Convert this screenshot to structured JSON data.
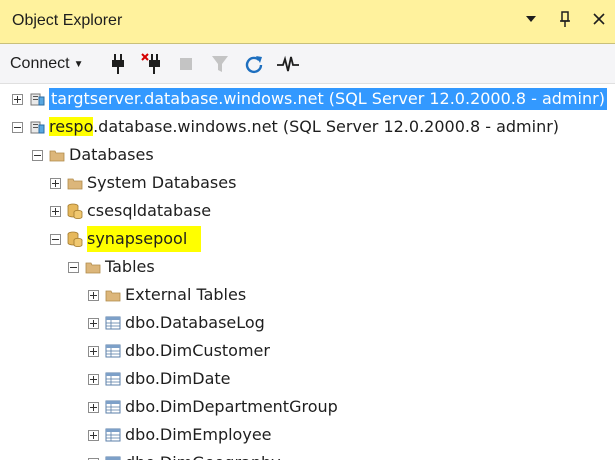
{
  "window": {
    "title": "Object Explorer"
  },
  "toolbar": {
    "connect_label": "Connect",
    "icons": [
      "connect-plug-icon",
      "disconnect-icon",
      "stop-icon",
      "filter-icon",
      "refresh-icon",
      "activity-monitor-icon"
    ]
  },
  "tree": {
    "server1": {
      "label": "targtserver.database.windows.net (SQL Server 12.0.2000.8 - adminr)",
      "state": "collapsed",
      "selected": true
    },
    "server2": {
      "prefix": "respo",
      "suffix": ".database.windows.net (SQL Server 12.0.2000.8 - adminr)",
      "state": "expanded"
    },
    "databases": {
      "label": "Databases"
    },
    "system_databases": {
      "label": "System Databases"
    },
    "db_csesql": {
      "label": "csesqldatabase"
    },
    "db_synapse": {
      "label": "synapsepool"
    },
    "tables": {
      "label": "Tables"
    },
    "external_tables": {
      "label": "External Tables"
    },
    "table_items": [
      "dbo.DatabaseLog",
      "dbo.DimCustomer",
      "dbo.DimDate",
      "dbo.DimDepartmentGroup",
      "dbo.DimEmployee",
      "dbo.DimGeography"
    ]
  },
  "colors": {
    "titlebar": "#fff29d",
    "selection": "#3399ff",
    "highlight": "#ffff00"
  }
}
